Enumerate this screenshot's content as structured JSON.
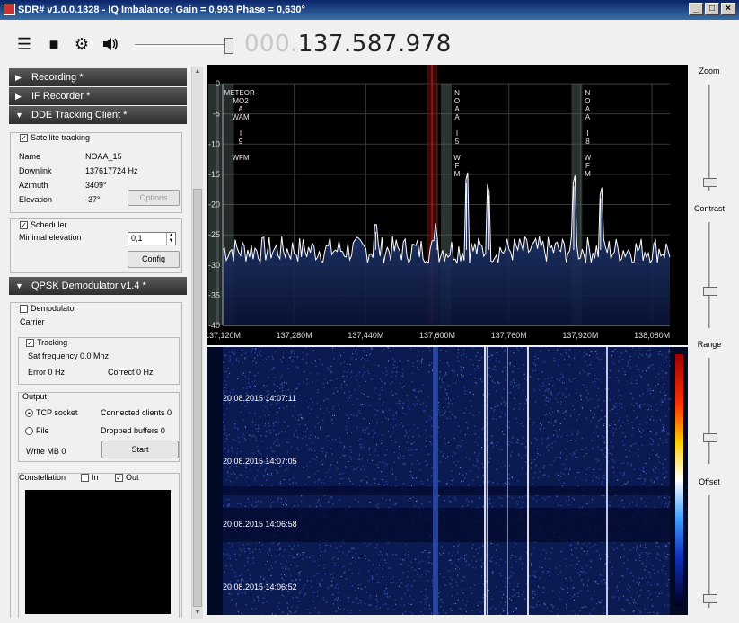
{
  "window": {
    "title": "SDR# v1.0.0.1328 - IQ Imbalance: Gain = 0,993 Phase = 0,630°"
  },
  "toolbar": {
    "frequency_dim": "000.",
    "frequency_main": "137.587.978",
    "icons": [
      "menu-icon",
      "stop-icon",
      "gear-icon",
      "speaker-icon"
    ]
  },
  "panels": {
    "recording": "Recording *",
    "if_recorder": "IF Recorder *",
    "dde_tracking": "DDE Tracking Client *",
    "qpsk": "QPSK Demodulator v1.4 *"
  },
  "dde": {
    "satellite_tracking": "Satellite tracking",
    "name_label": "Name",
    "name_value": "NOAA_15",
    "downlink_label": "Downlink",
    "downlink_value": "137617724 Hz",
    "azimuth_label": "Azimuth",
    "azimuth_value": "3409°",
    "elevation_label": "Elevation",
    "elevation_value": "-37°",
    "options_button": "Options"
  },
  "scheduler": {
    "label": "Scheduler",
    "min_elev_label": "Minimal elevation",
    "min_elev_value": "0,1",
    "config_button": "Config"
  },
  "qpsk": {
    "demodulator": "Demodulator",
    "carrier": "Carrier",
    "tracking": "Tracking",
    "sat_freq": "Sat frequency 0.0 Mhz",
    "error": "Error 0 Hz",
    "correct": "Correct 0 Hz",
    "output_label": "Output",
    "tcp_socket": "TCP socket",
    "connected_clients": "Connected clients 0",
    "file": "File",
    "dropped_buffers": "Dropped buffers 0",
    "write_mb": "Write MB 0",
    "start_button": "Start",
    "constellation_label": "Constellation",
    "in_label": "In",
    "out_label": "Out"
  },
  "right": {
    "zoom": "Zoom",
    "contrast": "Contrast",
    "range": "Range",
    "offset": "Offset"
  },
  "chart_data": {
    "type": "line",
    "xlabel": "",
    "ylabel": "",
    "y_ticks": [
      "0",
      "-5",
      "-10",
      "-15",
      "-20",
      "-25",
      "-30",
      "-35",
      "-40"
    ],
    "ylim": [
      -40,
      0
    ],
    "x_ticks": [
      "137,120M",
      "137,280M",
      "137,440M",
      "137,600M",
      "137,760M",
      "137,920M",
      "138,080M"
    ],
    "x_tick_values": [
      137.12,
      137.28,
      137.44,
      137.6,
      137.76,
      137.92,
      138.08
    ],
    "xlim": [
      137.12,
      138.12
    ],
    "grid": true,
    "noise_floor_db": -27.5,
    "peaks": [
      {
        "x": 137.462,
        "y": -24.5
      },
      {
        "x": 137.6,
        "y": -25.5
      },
      {
        "x": 137.665,
        "y": -16.5
      },
      {
        "x": 137.715,
        "y": -18.5
      },
      {
        "x": 137.905,
        "y": -17
      },
      {
        "x": 137.965,
        "y": -19
      }
    ],
    "markers": [
      {
        "label": "METEOR-MO2 A WAM I 9 WFM",
        "x": 137.1
      },
      {
        "label": "NOAA I5 WFM",
        "x": 137.62
      },
      {
        "label": "NOAA I8 WFM",
        "x": 137.912
      }
    ],
    "tuned_x": 137.588
  },
  "waterfall": {
    "timestamps": [
      "20.08.2015 14:07:11",
      "20.08.2015 14:07:05",
      "20.08.2015 14:06:58",
      "20.08.2015 14:06:52"
    ]
  }
}
